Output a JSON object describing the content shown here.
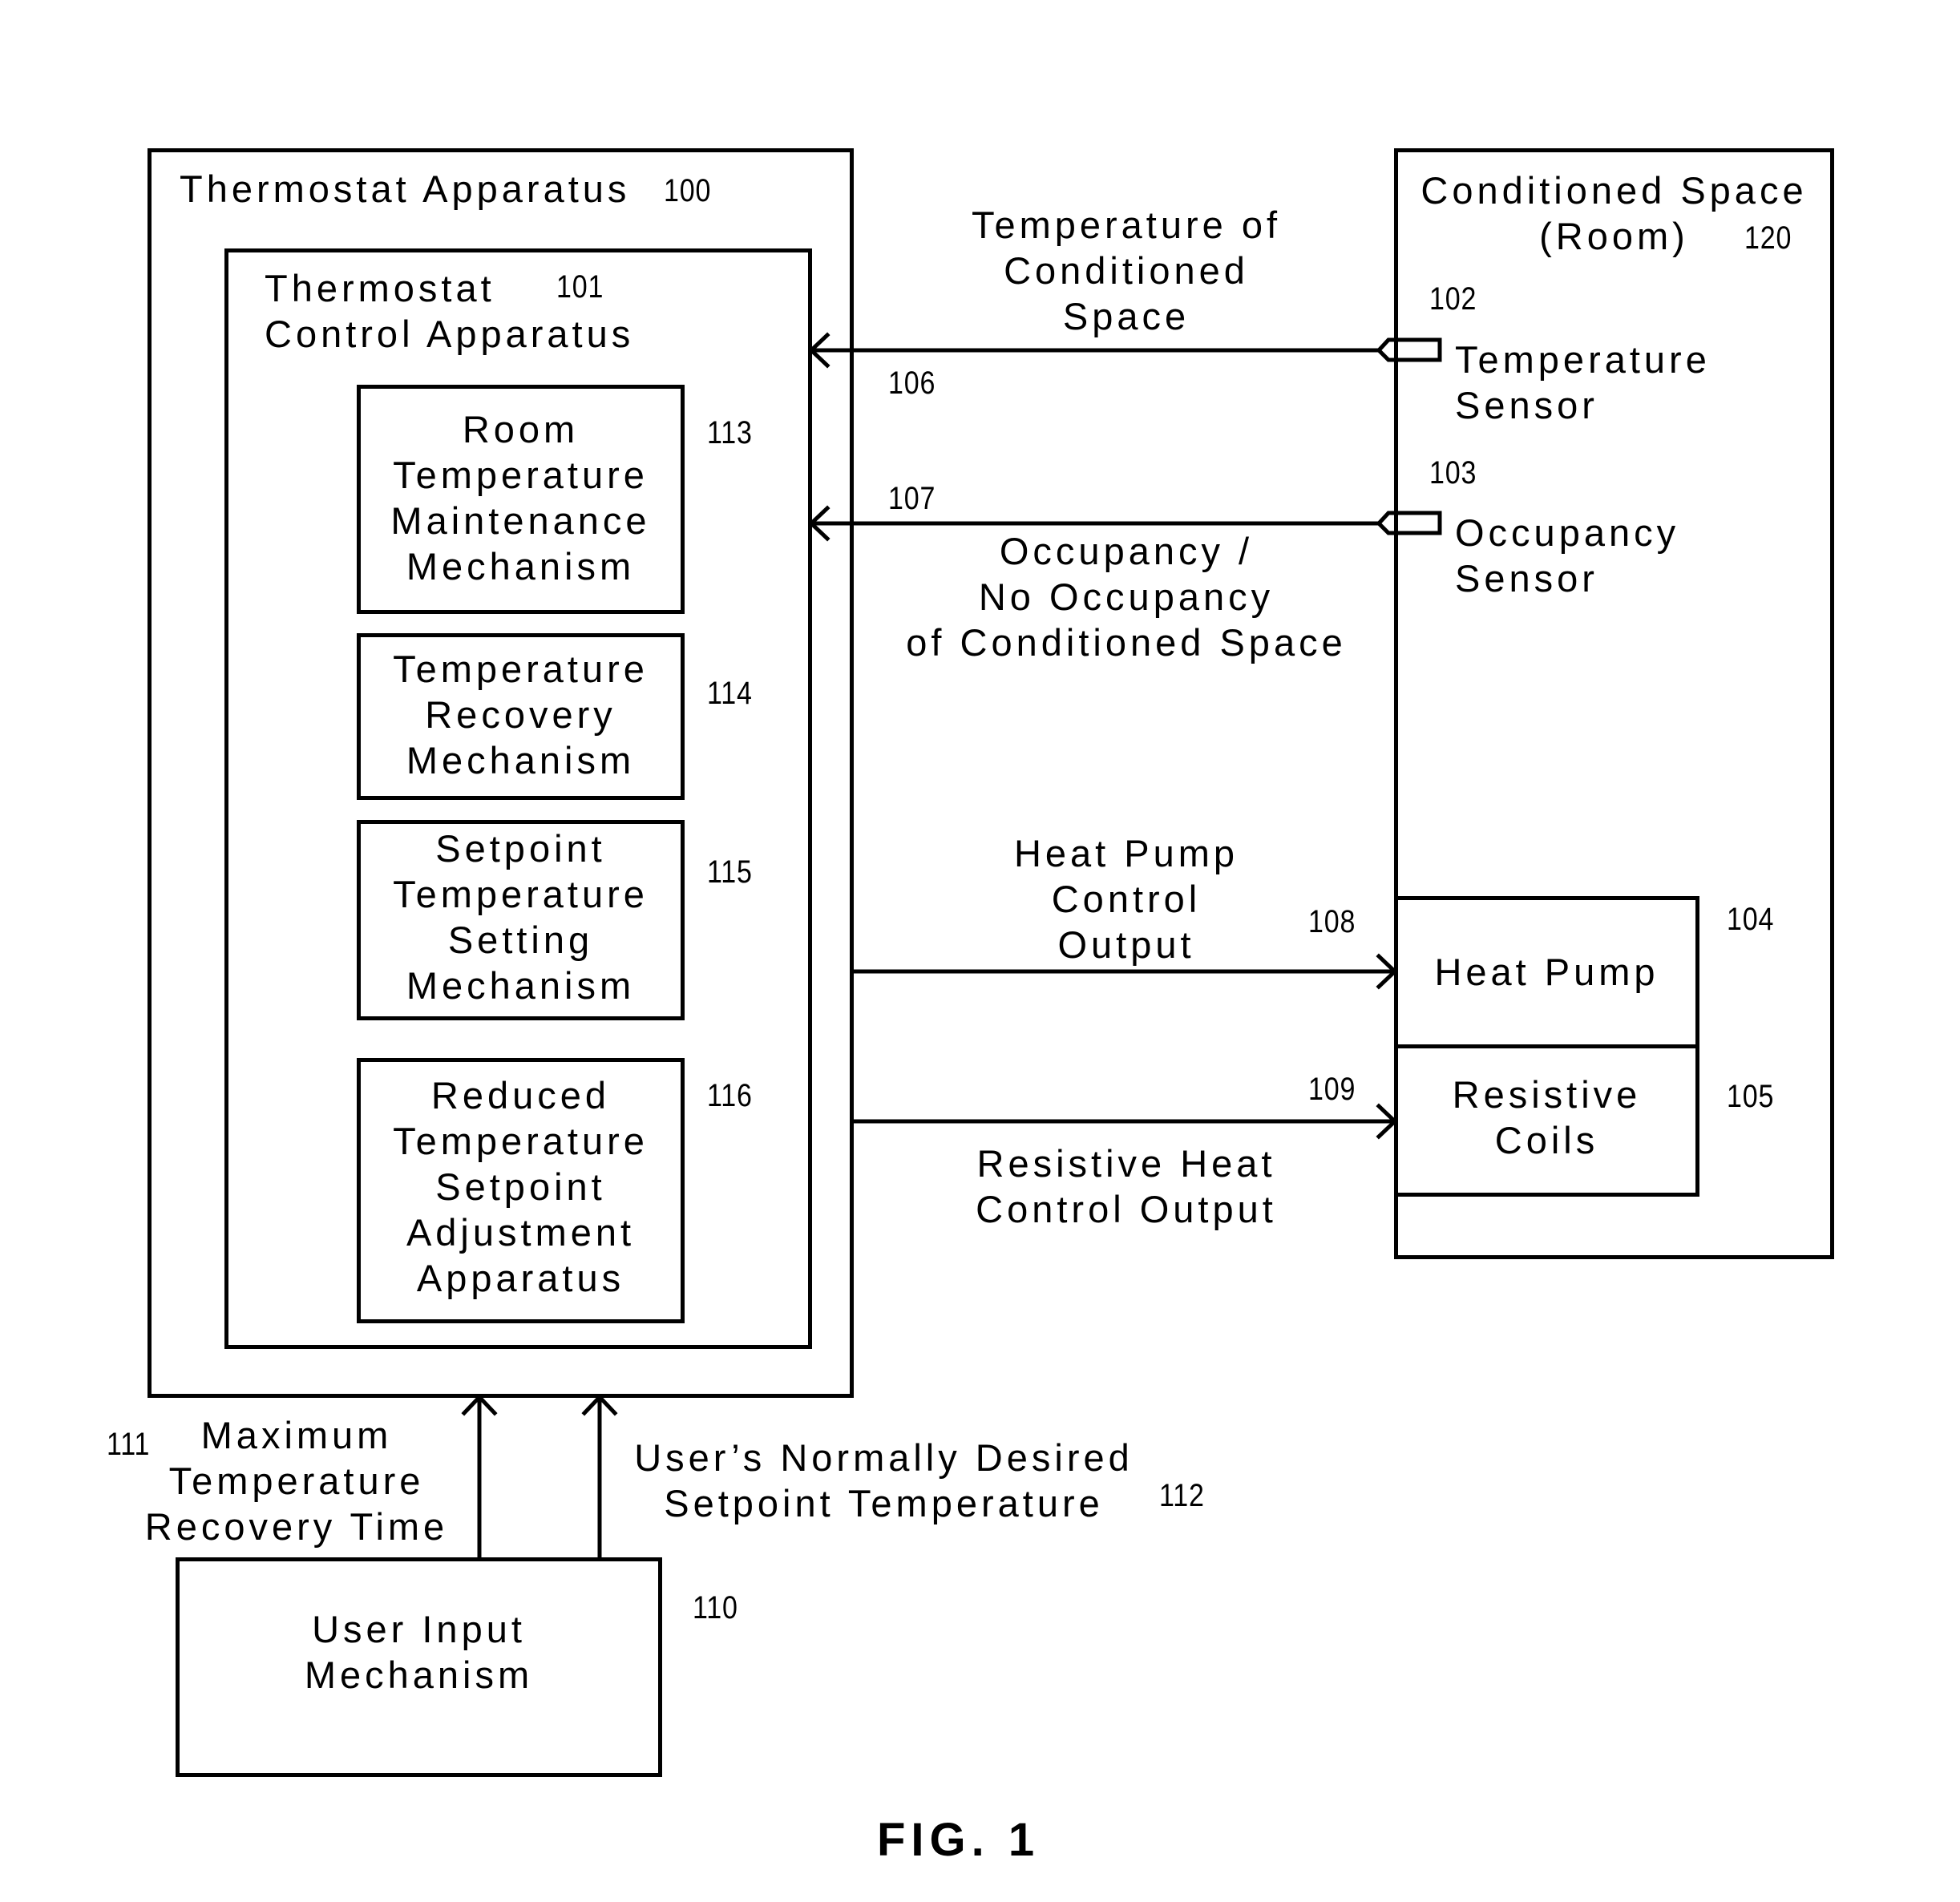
{
  "figure_label": "FIG. 1",
  "thermostat_apparatus": {
    "label": "Thermostat Apparatus",
    "ref": "100"
  },
  "thermostat_control": {
    "label": "Thermostat\nControl Apparatus",
    "ref": "101"
  },
  "mechanisms": [
    {
      "label": "Room\nTemperature\nMaintenance\nMechanism",
      "ref": "113"
    },
    {
      "label": "Temperature\nRecovery\nMechanism",
      "ref": "114"
    },
    {
      "label": "Setpoint\nTemperature\nSetting\nMechanism",
      "ref": "115"
    },
    {
      "label": "Reduced\nTemperature\nSetpoint\nAdjustment\nApparatus",
      "ref": "116"
    }
  ],
  "conditioned_space": {
    "label": "Conditioned Space\n(Room)",
    "ref": "120"
  },
  "sensors": [
    {
      "label": "Temperature\nSensor",
      "ref": "102"
    },
    {
      "label": "Occupancy\nSensor",
      "ref": "103"
    }
  ],
  "equipment": [
    {
      "label": "Heat Pump",
      "ref": "104"
    },
    {
      "label": "Resistive\nCoils",
      "ref": "105"
    }
  ],
  "signals": [
    {
      "label": "Temperature of\nConditioned\nSpace",
      "ref": "106",
      "direction": "room-to-thermostat"
    },
    {
      "label": "Occupancy /\nNo Occupancy\nof Conditioned Space",
      "ref": "107",
      "direction": "room-to-thermostat"
    },
    {
      "label": "Heat Pump\nControl\nOutput",
      "ref": "108",
      "direction": "thermostat-to-heat-pump"
    },
    {
      "label": "Resistive Heat\nControl Output",
      "ref": "109",
      "direction": "thermostat-to-coils"
    }
  ],
  "user_input": {
    "label": "User Input\nMechanism",
    "ref": "110"
  },
  "user_signals": [
    {
      "label": "Maximum\nTemperature\nRecovery Time",
      "ref": "111"
    },
    {
      "label": "User’s Normally Desired\nSetpoint Temperature",
      "ref": "112"
    }
  ]
}
